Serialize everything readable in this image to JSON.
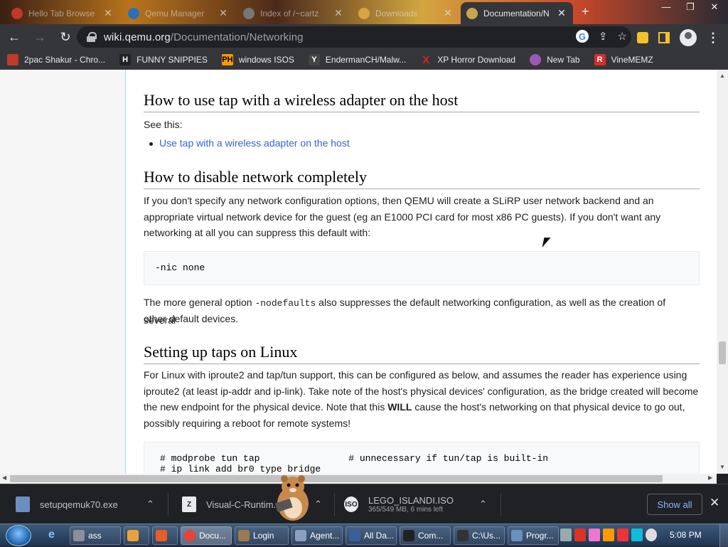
{
  "browser": {
    "tabs": [
      {
        "title": "Hello Tab Browse",
        "color": "#c0392b"
      },
      {
        "title": "Qemu Manager",
        "color": "#2c6fb7"
      },
      {
        "title": "Index of /~cartz",
        "color": "#777777"
      },
      {
        "title": "Downloads",
        "color": "#d9a441"
      },
      {
        "title": "Documentation/N",
        "color": "#c9a64b"
      }
    ],
    "new_tab_label": "+",
    "url_host": "wiki.qemu.org",
    "url_path": "/Documentation/Networking",
    "bookmarks": [
      {
        "label": "2pac Shakur - Chro...",
        "icon_text": "",
        "color": "#c0392b"
      },
      {
        "label": "FUNNY SNIPPIES",
        "icon_text": "H",
        "color": "#222222"
      },
      {
        "label": "windows ISOS",
        "icon_text": "PH",
        "color": "#f59b00"
      },
      {
        "label": "EndermanCH/Malw...",
        "icon_text": "Y",
        "color": "#444444"
      },
      {
        "label": "XP Horror Download",
        "icon_text": "X",
        "color": "#e02020"
      },
      {
        "label": "New Tab",
        "icon_text": "",
        "color": "#9b59b6"
      },
      {
        "label": "VineMEMZ",
        "icon_text": "R",
        "color": "#d32f2f"
      }
    ]
  },
  "article": {
    "h_wireless": "How to use tap with a wireless adapter on the host",
    "see_this": "See this:",
    "wireless_link": "Use tap with a wireless adapter on the host",
    "h_disable": "How to disable network completely",
    "disable_p1": "If you don't specify any network configuration options, then QEMU will create a SLiRP user network backend and an",
    "disable_p2": "appropriate virtual network device for the guest (eg an E1000 PCI card for most x86 PC guests). If you don't want any",
    "disable_p3": "networking at all you can suppress this default with:",
    "nic_none": "-nic none",
    "general_pre": "The more general option ",
    "nodefaults": "-nodefaults",
    "general_post": " also suppresses the default networking configuration, as well as the creation of several",
    "general_p2": "other default devices.",
    "h_linux": "Setting up taps on Linux",
    "linux_p1": "For Linux with iproute2 and tap/tun support, this can be configured as below, and assumes the reader has experience using",
    "linux_p2": "iproute2 (at least ip-addr and ip-link). Take note of the host's physical devices' configuration, as the bridge created will become",
    "linux_p3_pre": "the new endpoint for the physical device. Note that this ",
    "linux_p3_bold": "WILL",
    "linux_p3_post": " cause the host's networking on that physical device to go out,",
    "linux_p4": "possibly requiring a reboot for remote systems!",
    "code_line1": "# modprobe tun tap                # unnecessary if tun/tap is built-in",
    "code_line2": "# ip link add br0 type bridge"
  },
  "downloads": {
    "items": [
      {
        "name": "setupqemuk70.exe",
        "sub": ""
      },
      {
        "name": "Visual-C-Runtim...",
        "sub": ""
      },
      {
        "name": "LEGO_ISLANDI.ISO",
        "sub": "365/549 MB, 6 mins left"
      }
    ],
    "show_all": "Show all"
  },
  "taskbar": {
    "buttons": [
      {
        "label": "ass",
        "color": "#8a8f99"
      },
      {
        "label": "",
        "color": "#e8a23a"
      },
      {
        "label": "",
        "color": "#e85d2a"
      },
      {
        "label": "Docu...",
        "color": "#ea4335"
      },
      {
        "label": "Login",
        "color": "#9a7b4f"
      },
      {
        "label": "Agent...",
        "color": "#8aa0c0"
      },
      {
        "label": "All Da...",
        "color": "#3a5f9f"
      },
      {
        "label": "Com...",
        "color": "#222222"
      },
      {
        "label": "C:\\Us...",
        "color": "#333333"
      },
      {
        "label": "Progr...",
        "color": "#6a8fc0"
      }
    ],
    "clock": "5:08 PM"
  }
}
